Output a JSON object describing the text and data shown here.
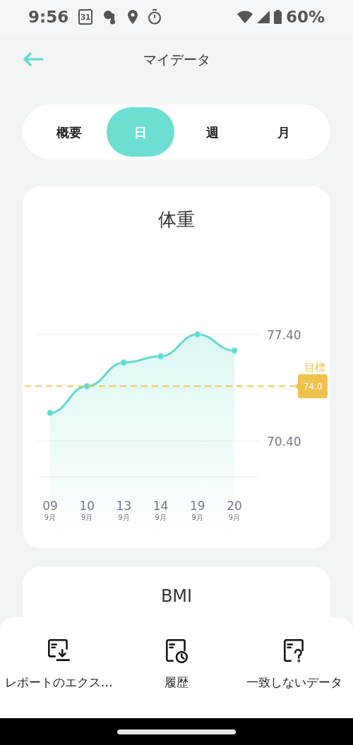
{
  "status_bar": {
    "time": "9:56",
    "calendar_day": "31",
    "battery": "60%"
  },
  "header": {
    "title": "マイデータ"
  },
  "tabs": [
    {
      "label": "概要",
      "selected": false
    },
    {
      "label": "日",
      "selected": true
    },
    {
      "label": "週",
      "selected": false
    },
    {
      "label": "月",
      "selected": false
    }
  ],
  "weight_card": {
    "title": "体重",
    "category_months": [
      "9月",
      "9月",
      "9月",
      "9月",
      "9月",
      "9月"
    ],
    "chart_data": {
      "type": "area",
      "categories": [
        "09",
        "10",
        "13",
        "14",
        "19",
        "20"
      ],
      "series": [
        {
          "color": "#5fdcc9",
          "values": [
            72.25,
            74.0,
            75.55,
            75.96,
            77.4,
            76.33
          ]
        }
      ],
      "ylim": [
        68.05,
        77.4
      ],
      "yticks": [
        {
          "value": 77.4,
          "label": "77.40"
        },
        {
          "value": 70.4,
          "label": "70.40"
        }
      ]
    },
    "goal": {
      "label": "目標",
      "value": "74.0"
    }
  },
  "bmi_card": {
    "title": "BMI"
  },
  "actions": [
    {
      "kind": "export",
      "label": "レポートのエクス…"
    },
    {
      "kind": "history",
      "label": "履歴"
    },
    {
      "kind": "mismatch",
      "label": "一致しないデータ"
    }
  ]
}
